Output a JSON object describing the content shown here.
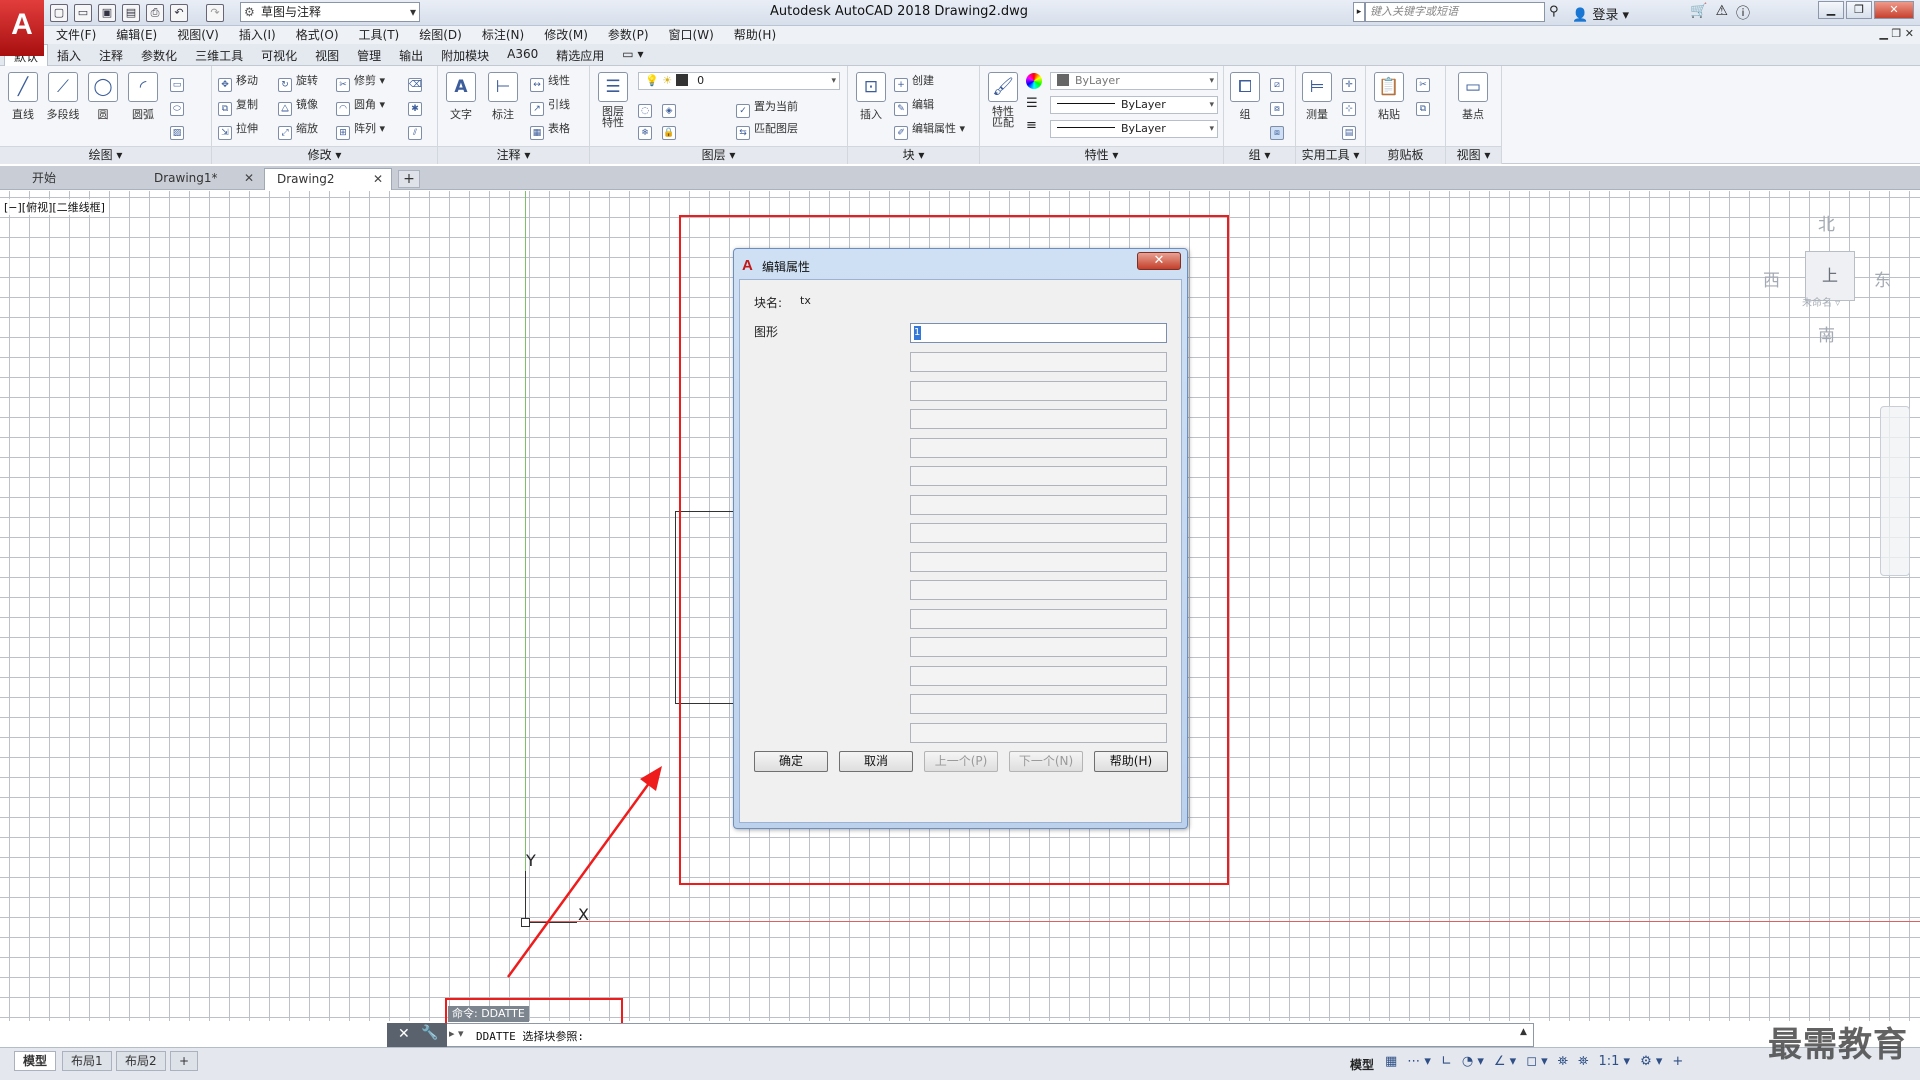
{
  "app": {
    "logo": "A",
    "window_title": "Autodesk AutoCAD 2018    Drawing2.dwg",
    "workspace": "草图与注释",
    "search_placeholder": "键入关键字或短语",
    "login": "登录"
  },
  "menu": [
    "文件(F)",
    "编辑(E)",
    "视图(V)",
    "插入(I)",
    "格式(O)",
    "工具(T)",
    "绘图(D)",
    "标注(N)",
    "修改(M)",
    "参数(P)",
    "窗口(W)",
    "帮助(H)"
  ],
  "ribbon_tabs": [
    "默认",
    "插入",
    "注释",
    "参数化",
    "三维工具",
    "可视化",
    "视图",
    "管理",
    "输出",
    "附加模块",
    "A360",
    "精选应用",
    "▭ ▾"
  ],
  "ribbon": {
    "draw": {
      "title": "绘图 ▾",
      "line": "直线",
      "polyline": "多段线",
      "circle": "圆",
      "arc": "圆弧"
    },
    "modify": {
      "title": "修改 ▾",
      "move": "移动",
      "rotate": "旋转",
      "trim": "修剪",
      "copy": "复制",
      "mirror": "镜像",
      "fillet": "圆角",
      "stretch": "拉伸",
      "scale": "缩放",
      "array": "阵列"
    },
    "annotation": {
      "title": "注释 ▾",
      "text": "文字",
      "dimension": "标注",
      "linear": "线性",
      "leader": "引线",
      "table": "表格"
    },
    "layers": {
      "title": "图层 ▾",
      "layer_props": "图层\n特性",
      "current_layer": "0",
      "set_current": "置为当前",
      "match_layer": "匹配图层"
    },
    "block": {
      "title": "块 ▾",
      "insert": "插入",
      "create": "创建",
      "edit": "编辑",
      "edit_attr": "编辑属性"
    },
    "properties": {
      "title": "特性 ▾",
      "match": "特性\n匹配",
      "color": "ByLayer",
      "linetype": "ByLayer",
      "lineweight": "ByLayer"
    },
    "group": {
      "title": "组 ▾",
      "group": "组"
    },
    "utilities": {
      "title": "实用工具 ▾",
      "measure": "测量"
    },
    "clipboard": {
      "title": "剪贴板",
      "paste": "粘贴"
    },
    "view": {
      "title": "视图 ▾",
      "base": "基点"
    }
  },
  "doc_tabs": [
    {
      "label": "开始"
    },
    {
      "label": "Drawing1*"
    },
    {
      "label": "Drawing2"
    }
  ],
  "viewport_label": "[−][俯视][二维线框]",
  "viewcube": {
    "north": "北",
    "south": "南",
    "east": "东",
    "west": "西",
    "face": "上",
    "unnamed": "未命名 ▿"
  },
  "ucs": {
    "x": "X",
    "y": "Y"
  },
  "dialog": {
    "logo": "A",
    "title": "编辑属性",
    "close": "✕",
    "block_name_label": "块名:",
    "block_name_value": "tx",
    "attribute_label": "图形",
    "attribute_value": "1",
    "buttons": {
      "ok": "确定",
      "cancel": "取消",
      "prev": "上一个(P)",
      "next": "下一个(N)",
      "help": "帮助(H)"
    }
  },
  "command": {
    "history": "命令: DDATTE",
    "prompt": "DDATTE 选择块参照:"
  },
  "status": {
    "layouts": [
      "模型",
      "布局1",
      "布局2"
    ],
    "model_toggle": "模型",
    "scale": "1:1 ▾"
  },
  "watermark": "最需教育",
  "colors": {
    "annotation_red": "#ef1c1c",
    "dialog_frame": "#bcd1ec",
    "accent_blue": "#3477d8"
  }
}
